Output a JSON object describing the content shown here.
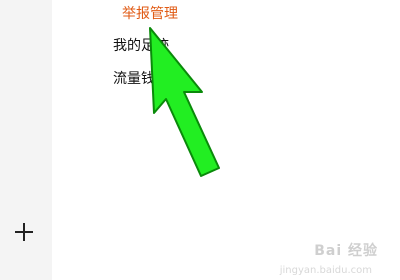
{
  "menu": {
    "items": [
      {
        "label": "举报管理",
        "active": true
      },
      {
        "label": "我的足迹",
        "active": false
      },
      {
        "label": "流量钱包",
        "active": false
      }
    ]
  },
  "floating_action": {
    "icon": "plus-icon"
  },
  "annotation": {
    "icon": "arrow-pointer-icon",
    "color": "#22ee22"
  },
  "watermark": {
    "text": "Bai 经验",
    "subtext": "jingyan.baidu.com"
  },
  "colors": {
    "active_menu": "#e05a14",
    "menu_text": "#111111"
  }
}
